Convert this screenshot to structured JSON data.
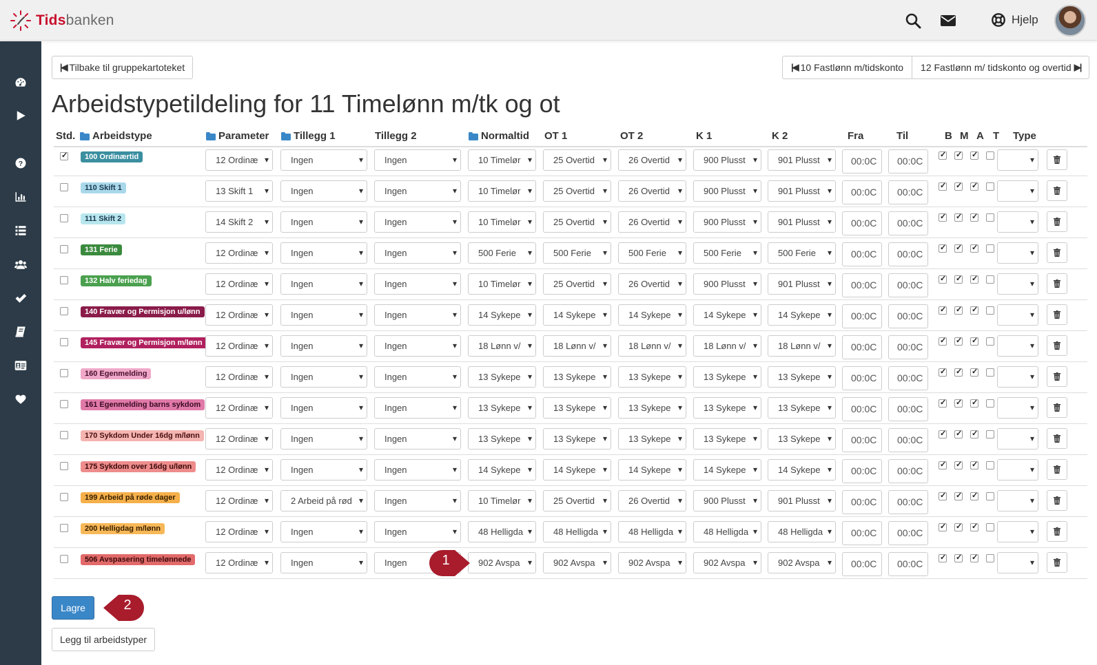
{
  "app": {
    "brand_part1": "Tids",
    "brand_part2": "banken",
    "help_label": "Hjelp"
  },
  "nav": {
    "back_label": "Tilbake til gruppekartoteket",
    "prev_label": "10 Fastlønn m/tidskonto",
    "next_label": "12 Fastlønn m/ tidskonto og overtid"
  },
  "page": {
    "title": "Arbeidstypetildeling for 11 Timelønn m/tk og ot"
  },
  "columns": {
    "std": "Std.",
    "arbeidstype": "Arbeidstype",
    "parameter": "Parameter",
    "tillegg1": "Tillegg 1",
    "tillegg2": "Tillegg 2",
    "normaltid": "Normaltid",
    "ot1": "OT 1",
    "ot2": "OT 2",
    "k1": "K 1",
    "k2": "K 2",
    "fra": "Fra",
    "til": "Til",
    "b": "B",
    "m": "M",
    "a": "A",
    "t": "T",
    "type": "Type"
  },
  "rows": [
    {
      "std": true,
      "label": "100 Ordinærtid",
      "label_color": "#3a8fa0",
      "label_text_color": "#ffffff",
      "parameter": "12 Ordinæ",
      "tillegg1": "Ingen",
      "tillegg2": "Ingen",
      "normaltid": "10 Timelør",
      "ot1": "25 Overtid",
      "ot2": "26 Overtid",
      "k1": "900 Plusst",
      "k2": "901 Plusst",
      "fra": "00:0C",
      "til": "00:0C",
      "b": true,
      "m": true,
      "a": true,
      "t": false,
      "type": ""
    },
    {
      "std": false,
      "label": "110 Skift 1",
      "label_color": "#a9d8ea",
      "label_text_color": "#1a3a50",
      "parameter": "13 Skift 1",
      "tillegg1": "Ingen",
      "tillegg2": "Ingen",
      "normaltid": "10 Timelør",
      "ot1": "25 Overtid",
      "ot2": "26 Overtid",
      "k1": "900 Plusst",
      "k2": "901 Plusst",
      "fra": "00:0C",
      "til": "00:0C",
      "b": true,
      "m": true,
      "a": true,
      "t": false,
      "type": ""
    },
    {
      "std": false,
      "label": "111 Skift 2",
      "label_color": "#b8e6ee",
      "label_text_color": "#1a3a50",
      "parameter": "14 Skift 2",
      "tillegg1": "Ingen",
      "tillegg2": "Ingen",
      "normaltid": "10 Timelør",
      "ot1": "25 Overtid",
      "ot2": "26 Overtid",
      "k1": "900 Plusst",
      "k2": "901 Plusst",
      "fra": "00:0C",
      "til": "00:0C",
      "b": true,
      "m": true,
      "a": true,
      "t": false,
      "type": ""
    },
    {
      "std": false,
      "label": "131 Ferie",
      "label_color": "#3b8a3e",
      "label_text_color": "#ffffff",
      "parameter": "12 Ordinæ",
      "tillegg1": "Ingen",
      "tillegg2": "Ingen",
      "normaltid": "500 Ferie",
      "ot1": "500 Ferie",
      "ot2": "500 Ferie",
      "k1": "500 Ferie",
      "k2": "500 Ferie",
      "fra": "00:0C",
      "til": "00:0C",
      "b": true,
      "m": true,
      "a": true,
      "t": false,
      "type": ""
    },
    {
      "std": false,
      "label": "132 Halv feriedag",
      "label_color": "#4aa04e",
      "label_text_color": "#ffffff",
      "parameter": "12 Ordinæ",
      "tillegg1": "Ingen",
      "tillegg2": "Ingen",
      "normaltid": "10 Timelør",
      "ot1": "25 Overtid",
      "ot2": "26 Overtid",
      "k1": "900 Plusst",
      "k2": "901 Plusst",
      "fra": "00:0C",
      "til": "00:0C",
      "b": true,
      "m": true,
      "a": true,
      "t": false,
      "type": ""
    },
    {
      "std": false,
      "label": "140 Fravær og Permisjon u/lønn",
      "label_color": "#8a1c4a",
      "label_text_color": "#ffffff",
      "parameter": "12 Ordinæ",
      "tillegg1": "Ingen",
      "tillegg2": "Ingen",
      "normaltid": "14 Sykepe",
      "ot1": "14 Sykepe",
      "ot2": "14 Sykepe",
      "k1": "14 Sykepe",
      "k2": "14 Sykepe",
      "fra": "00:0C",
      "til": "00:0C",
      "b": true,
      "m": true,
      "a": true,
      "t": false,
      "type": ""
    },
    {
      "std": false,
      "label": "145 Fravær og Permisjon m/lønn",
      "label_color": "#b0205e",
      "label_text_color": "#ffffff",
      "parameter": "12 Ordinæ",
      "tillegg1": "Ingen",
      "tillegg2": "Ingen",
      "normaltid": "18 Lønn v/",
      "ot1": "18 Lønn v/",
      "ot2": "18 Lønn v/",
      "k1": "18 Lønn v/",
      "k2": "18 Lønn v/",
      "fra": "00:0C",
      "til": "00:0C",
      "b": true,
      "m": true,
      "a": true,
      "t": false,
      "type": ""
    },
    {
      "std": false,
      "label": "160 Egenmelding",
      "label_color": "#f0a8c8",
      "label_text_color": "#4a1030",
      "parameter": "12 Ordinæ",
      "tillegg1": "Ingen",
      "tillegg2": "Ingen",
      "normaltid": "13 Sykepe",
      "ot1": "13 Sykepe",
      "ot2": "13 Sykepe",
      "k1": "13 Sykepe",
      "k2": "13 Sykepe",
      "fra": "00:0C",
      "til": "00:0C",
      "b": true,
      "m": true,
      "a": true,
      "t": false,
      "type": ""
    },
    {
      "std": false,
      "label": "161 Egenmelding barns sykdom",
      "label_color": "#e07aa8",
      "label_text_color": "#3a0a22",
      "parameter": "12 Ordinæ",
      "tillegg1": "Ingen",
      "tillegg2": "Ingen",
      "normaltid": "13 Sykepe",
      "ot1": "13 Sykepe",
      "ot2": "13 Sykepe",
      "k1": "13 Sykepe",
      "k2": "13 Sykepe",
      "fra": "00:0C",
      "til": "00:0C",
      "b": true,
      "m": true,
      "a": true,
      "t": false,
      "type": ""
    },
    {
      "std": false,
      "label": "170 Sykdom Under 16dg m/lønn",
      "label_color": "#f4b4b0",
      "label_text_color": "#4a1010",
      "parameter": "12 Ordinæ",
      "tillegg1": "Ingen",
      "tillegg2": "Ingen",
      "normaltid": "13 Sykepe",
      "ot1": "13 Sykepe",
      "ot2": "13 Sykepe",
      "k1": "13 Sykepe",
      "k2": "13 Sykepe",
      "fra": "00:0C",
      "til": "00:0C",
      "b": true,
      "m": true,
      "a": true,
      "t": false,
      "type": ""
    },
    {
      "std": false,
      "label": "175 Sykdom over 16dg u/lønn",
      "label_color": "#ee8c8c",
      "label_text_color": "#3a0a0a",
      "parameter": "12 Ordinæ",
      "tillegg1": "Ingen",
      "tillegg2": "Ingen",
      "normaltid": "14 Sykepe",
      "ot1": "14 Sykepe",
      "ot2": "14 Sykepe",
      "k1": "14 Sykepe",
      "k2": "14 Sykepe",
      "fra": "00:0C",
      "til": "00:0C",
      "b": true,
      "m": true,
      "a": true,
      "t": false,
      "type": ""
    },
    {
      "std": false,
      "label": "199 Arbeid på røde dager",
      "label_color": "#f5b04a",
      "label_text_color": "#3a2000",
      "parameter": "12 Ordinæ",
      "tillegg1": "2 Arbeid på rød",
      "tillegg2": "Ingen",
      "normaltid": "10 Timelør",
      "ot1": "25 Overtid",
      "ot2": "26 Overtid",
      "k1": "900 Plusst",
      "k2": "901 Plusst",
      "fra": "00:0C",
      "til": "00:0C",
      "b": true,
      "m": true,
      "a": true,
      "t": false,
      "type": ""
    },
    {
      "std": false,
      "label": "200 Helligdag m/lønn",
      "label_color": "#f7b858",
      "label_text_color": "#3a2000",
      "parameter": "12 Ordinæ",
      "tillegg1": "Ingen",
      "tillegg2": "Ingen",
      "normaltid": "48 Helligda",
      "ot1": "48 Helligda",
      "ot2": "48 Helligda",
      "k1": "48 Helligda",
      "k2": "48 Helligda",
      "fra": "00:0C",
      "til": "00:0C",
      "b": true,
      "m": true,
      "a": true,
      "t": false,
      "type": ""
    },
    {
      "std": false,
      "label": "506 Avspasering timelønnede",
      "label_color": "#e26a6a",
      "label_text_color": "#3a0a0a",
      "parameter": "12 Ordinæ",
      "tillegg1": "Ingen",
      "tillegg2": "Ingen",
      "normaltid": "902 Avspa",
      "ot1": "902 Avspa",
      "ot2": "902 Avspa",
      "k1": "902 Avspa",
      "k2": "902 Avspa",
      "fra": "00:0C",
      "til": "00:0C",
      "b": true,
      "m": true,
      "a": true,
      "t": false,
      "type": ""
    }
  ],
  "actions": {
    "save_label": "Lagre",
    "add_label": "Legg til arbeidstyper"
  },
  "callouts": [
    {
      "number": "1"
    },
    {
      "number": "2"
    }
  ],
  "colors": {
    "sidebar": "#2c3b47",
    "primary": "#3a87c8",
    "callout": "#a81c2c",
    "brand_red": "#c8102e"
  }
}
